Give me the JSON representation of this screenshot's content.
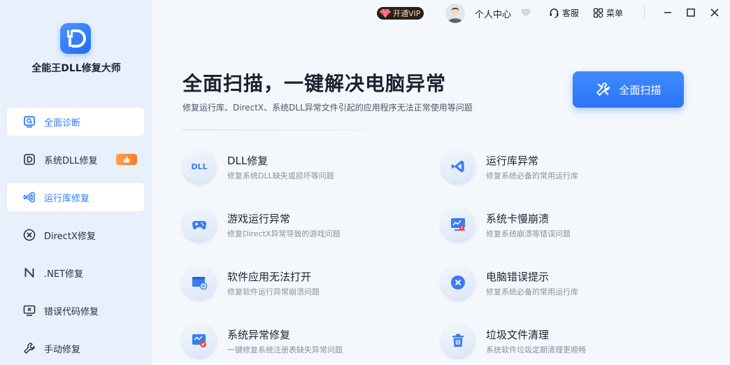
{
  "app": {
    "name": "全能王DLL修复大师"
  },
  "sidebar": {
    "items": [
      {
        "label": "全面诊断"
      },
      {
        "label": "系统DLL修复"
      },
      {
        "label": "运行库修复"
      },
      {
        "label": "DirectX修复"
      },
      {
        "label": ".NET修复"
      },
      {
        "label": "错误代码修复"
      },
      {
        "label": "手动修复"
      }
    ]
  },
  "titlebar": {
    "vip_label": "开通VIP",
    "user_center": "个人中心",
    "service": "客服",
    "menu": "菜单"
  },
  "hero": {
    "title": "全面扫描，一键解决电脑异常",
    "subtitle": "修复运行库、DirectX、系统DLL异常文件引起的应用程序无法正常使用等问题",
    "scan_button": "全面扫描"
  },
  "features": [
    {
      "title": "DLL修复",
      "desc": "修复系统DLL缺失或损坏等问题",
      "icon_text": "DLL",
      "icon": "dll-icon"
    },
    {
      "title": "运行库异常",
      "desc": "修复系统必备的常用运行库",
      "icon": "vs-runtime-icon"
    },
    {
      "title": "游戏运行异常",
      "desc": "修复DirectX异常导致的游戏问题",
      "icon": "gamepad-icon"
    },
    {
      "title": "系统卡慢崩溃",
      "desc": "修复系统崩溃等错误问题",
      "icon": "monitor-warning-icon"
    },
    {
      "title": "软件应用无法打开",
      "desc": "修复软件运行异常崩溃问题",
      "icon": "app-error-icon"
    },
    {
      "title": "电脑错误提示",
      "desc": "修复系统必备的常用运行库",
      "icon": "error-x-icon"
    },
    {
      "title": "系统异常修复",
      "desc": "一键修复系统注册表缺失异常问题",
      "icon": "system-repair-icon"
    },
    {
      "title": "垃圾文件清理",
      "desc": "系统软件垃圾定期清理更顺畅",
      "icon": "trash-icon"
    }
  ],
  "colors": {
    "accent": "#2f7cf6",
    "sidebar_bg": "#e7f0fb",
    "page_bg": "#f4f8fd",
    "hot": "#ff8a2e"
  }
}
